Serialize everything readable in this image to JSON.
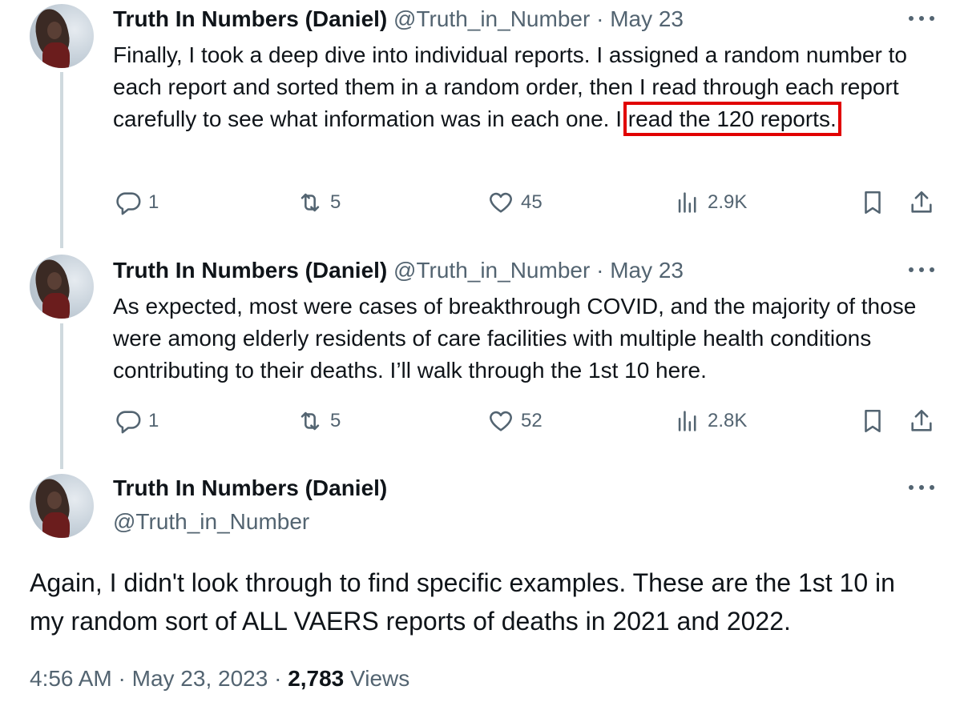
{
  "tweets": [
    {
      "name": "Truth In Numbers (Daniel)",
      "handle": "@Truth_in_Number",
      "date": "May 23",
      "text_before": "Finally, I took a deep dive into individual reports. I assigned a random number to each report and sorted them in a random order, then I read through each report carefully to see what information was in each one. I ",
      "text_highlight": "read the 120 reports.",
      "replies": "1",
      "retweets": "5",
      "likes": "45",
      "views": "2.9K"
    },
    {
      "name": "Truth In Numbers (Daniel)",
      "handle": "@Truth_in_Number",
      "date": "May 23",
      "text": "As expected, most were cases of breakthrough COVID, and the majority of those were among elderly residents of care facilities with multiple health conditions contributing to their deaths. I’ll walk through the 1st 10 here.",
      "replies": "1",
      "retweets": "5",
      "likes": "52",
      "views": "2.8K"
    }
  ],
  "main_tweet": {
    "name": "Truth In Numbers (Daniel)",
    "handle": "@Truth_in_Number",
    "text": "Again, I didn't look through to find specific examples. These are the 1st 10 in my random sort of ALL VAERS reports of deaths in 2021 and 2022.",
    "time": "4:56 AM",
    "date": "May 23, 2023",
    "views_count": "2,783",
    "views_label": "Views"
  },
  "separator": " · ",
  "colors": {
    "text": "#0f1419",
    "secondary": "#536471",
    "highlight": "#e10000",
    "thread": "#cfd9de"
  },
  "icons": [
    "reply-icon",
    "retweet-icon",
    "like-icon",
    "views-icon",
    "bookmark-icon",
    "share-icon",
    "more-icon"
  ]
}
